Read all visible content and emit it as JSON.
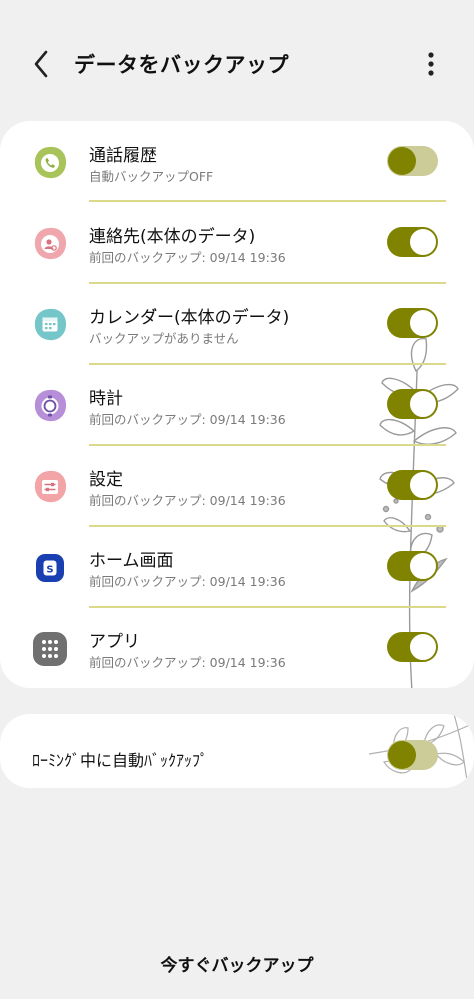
{
  "header": {
    "title": "データをバックアップ",
    "back_icon": "chevron-left-icon",
    "more_icon": "more-vertical-icon"
  },
  "backup_items": [
    {
      "title": "通話履歴",
      "subtitle": "自動バックアップOFF",
      "icon": "phone-icon",
      "toggle_on": false
    },
    {
      "title": "連絡先(本体のデ゙ータ)",
      "subtitle": "前回のバックアップ: 09/14 19:36",
      "icon": "contacts-icon",
      "toggle_on": true
    },
    {
      "title": "カレンダ゙ー(本体のデ゙ータ)",
      "subtitle": "バックアップがありません",
      "icon": "calendar-icon",
      "toggle_on": true
    },
    {
      "title": "時計",
      "subtitle": "前回のバックアップ: 09/14 19:36",
      "icon": "clock-icon",
      "toggle_on": true
    },
    {
      "title": "設定",
      "subtitle": "前回のバックアップ: 09/14 19:36",
      "icon": "settings-icon",
      "toggle_on": true
    },
    {
      "title": "ホーム画面",
      "subtitle": "前回のバックアップ: 09/14 19:36",
      "icon": "home-screen-icon",
      "toggle_on": true
    },
    {
      "title": "アプリ",
      "subtitle": "前回のバックアップ: 09/14 19:36",
      "icon": "apps-grid-icon",
      "toggle_on": true
    }
  ],
  "roaming": {
    "label": "ﾛｰﾐﾝｸﾞ中に自動ﾊﾞｯｸｱｯﾌﾟ",
    "toggle_on": false
  },
  "footer": {
    "backup_now_label": "今すぐバックアップ"
  },
  "colors": {
    "accent": "#7f8300",
    "divider": "#dcd98a",
    "toggle_off_track": "#cccc99",
    "background": "#f0f0f0"
  }
}
